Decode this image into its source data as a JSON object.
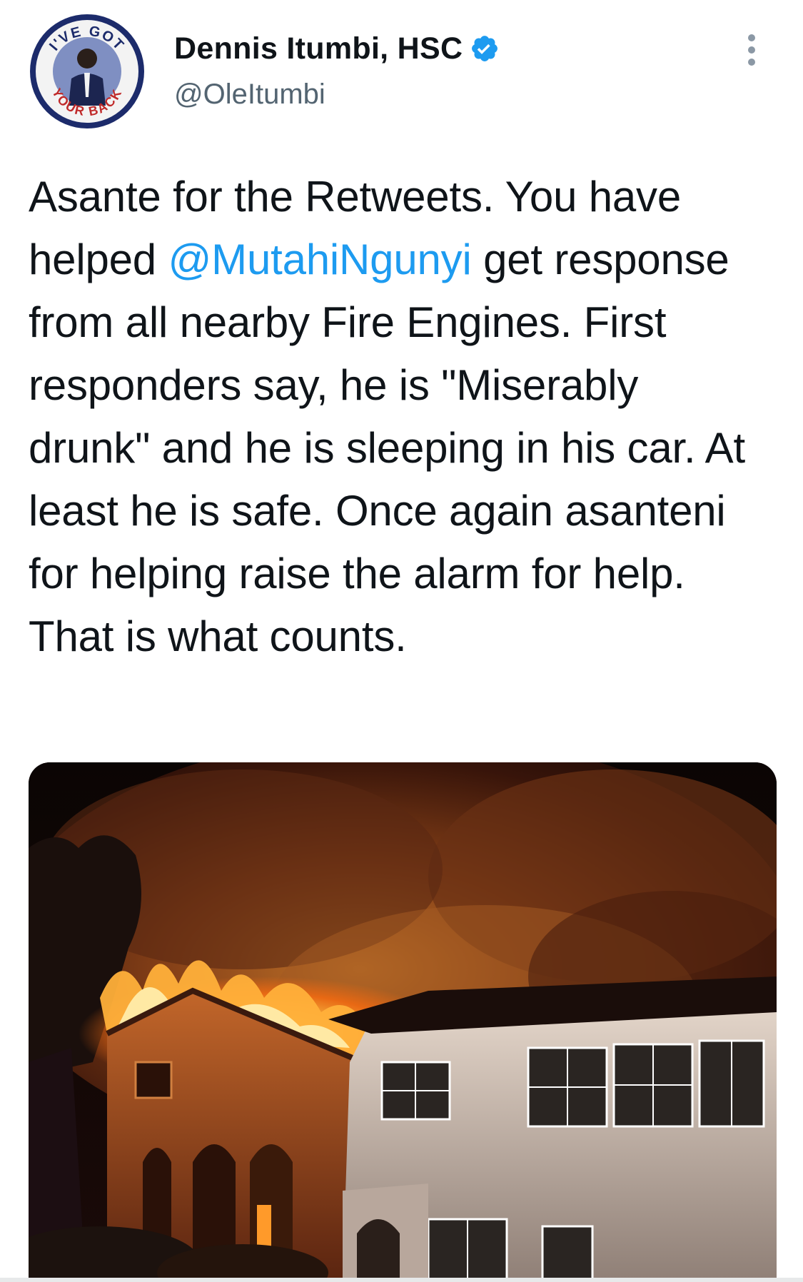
{
  "author": {
    "display_name": "Dennis Itumbi, HSC",
    "handle": "@OleItumbi",
    "verified": true,
    "avatar_badge_text_top": "I'VE GOT",
    "avatar_badge_text_bottom": "YOUR BACK"
  },
  "tweet": {
    "text_before_mention": "Asante for the Retweets. You have helped ",
    "mention": "@MutahiNgunyi",
    "text_after_mention": " get response from all nearby Fire Engines. First responders say, he is \"Miserably drunk\" and he is sleeping in his car. At least he is safe. Once again asanteni for helping raise the alarm for help. That is what counts."
  },
  "icons": {
    "verified": "verified-badge-icon",
    "more": "more-options-icon"
  },
  "colors": {
    "mention": "#1d9bf0",
    "verified": "#1d9bf0",
    "handle": "#536471",
    "text": "#0f1419"
  }
}
